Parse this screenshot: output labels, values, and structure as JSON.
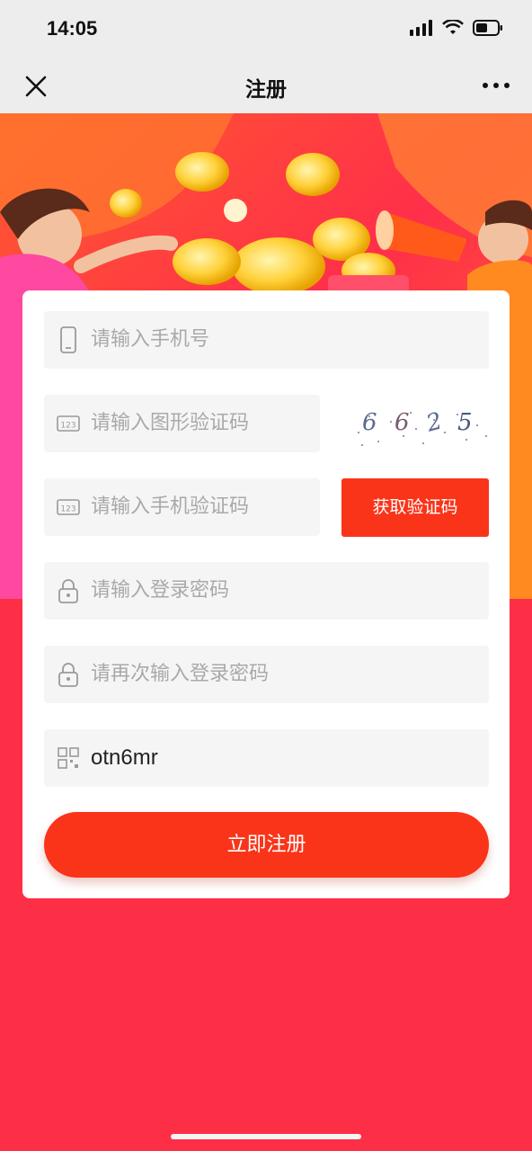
{
  "status": {
    "time": "14:05"
  },
  "nav": {
    "title": "注册",
    "close_icon": "close-icon",
    "more_icon": "more-icon"
  },
  "form": {
    "phone_placeholder": "请输入手机号",
    "captcha_placeholder": "请输入图形验证码",
    "captcha_digits": [
      "6",
      "6",
      "2",
      "5"
    ],
    "sms_placeholder": "请输入手机验证码",
    "sms_button": "获取验证码",
    "password_placeholder": "请输入登录密码",
    "password_confirm_placeholder": "请再次输入登录密码",
    "invite_code_value": "otn6mr",
    "submit_button": "立即注册"
  },
  "colors": {
    "accent": "#fa3419",
    "background": "#fd2f46",
    "field_bg": "#f5f5f5"
  }
}
